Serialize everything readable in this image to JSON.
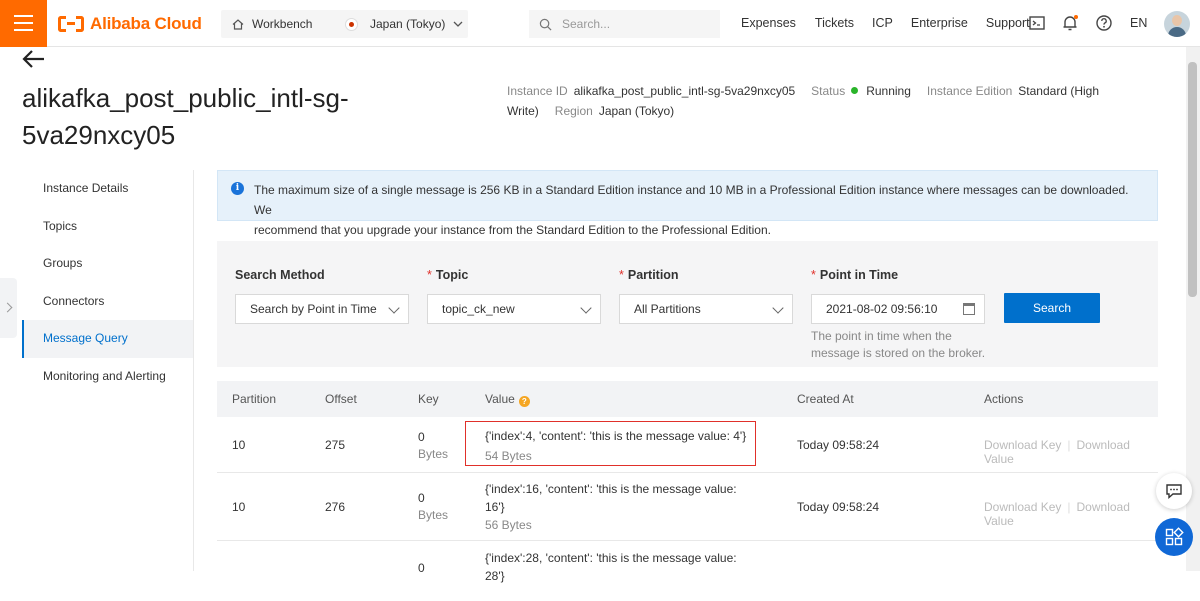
{
  "topbar": {
    "brand": "Alibaba Cloud",
    "workbench": "Workbench",
    "region": "Japan (Tokyo)",
    "search_placeholder": "Search...",
    "links": [
      "Expenses",
      "Tickets",
      "ICP",
      "Enterprise",
      "Support"
    ],
    "language": "EN",
    "icons": [
      "menu-icon",
      "home-icon",
      "chevron-down-icon",
      "search-icon",
      "terminal-icon",
      "bell-icon",
      "help-icon",
      "avatar"
    ]
  },
  "header": {
    "back_icon": "arrow-left-icon",
    "title_line1": "alikafka_post_public_intl-sg-",
    "title_line2": "5va29nxcy05",
    "instance_id_label": "Instance ID",
    "instance_id": "alikafka_post_public_intl-sg-5va29nxcy05",
    "status_label": "Status",
    "status": "Running",
    "edition_label": "Instance Edition",
    "edition_line1": "Standard (High",
    "edition_line2": "Write)",
    "region_label": "Region",
    "region": "Japan (Tokyo)"
  },
  "sidebar": {
    "items": [
      {
        "label": "Instance Details"
      },
      {
        "label": "Topics"
      },
      {
        "label": "Groups"
      },
      {
        "label": "Connectors"
      },
      {
        "label": "Message Query"
      },
      {
        "label": "Monitoring and Alerting"
      }
    ],
    "active_index": 4
  },
  "notice": {
    "line1": "The maximum size of a single message is 256 KB in a Standard Edition instance and 10 MB in a Professional Edition instance where messages can be downloaded. We",
    "line2": "recommend that you upgrade your instance from the Standard Edition to the Professional Edition."
  },
  "filters": {
    "search_method_label": "Search Method",
    "search_method_value": "Search by Point in Time",
    "topic_label": "Topic",
    "topic_value": "topic_ck_new",
    "partition_label": "Partition",
    "partition_value": "All Partitions",
    "point_label": "Point in Time",
    "point_value": "2021-08-02 09:56:10",
    "hint_line1": "The point in time when the",
    "hint_line2": "message is stored on the broker.",
    "search_button": "Search"
  },
  "table": {
    "columns": [
      "Partition",
      "Offset",
      "Key",
      "Value",
      "Created At",
      "Actions"
    ],
    "rows": [
      {
        "partition": "10",
        "offset": "275",
        "key": "0",
        "key_unit": "Bytes",
        "value_line1": "{'index':4, 'content': 'this is the message value: 4'}",
        "value_line2": "",
        "value_size": "54 Bytes",
        "created": "Today 09:58:24",
        "action1": "Download Key",
        "action2": "Download Value"
      },
      {
        "partition": "10",
        "offset": "276",
        "key": "0",
        "key_unit": "Bytes",
        "value_line1": "{'index':16, 'content': 'this is the message value:",
        "value_line2": "16'}",
        "value_size": "56 Bytes",
        "created": "Today 09:58:24",
        "action1": "Download Key",
        "action2": "Download Value"
      },
      {
        "partition": "",
        "offset": "",
        "key": "0",
        "key_unit": "",
        "value_line1": "{'index':28, 'content': 'this is the message value:",
        "value_line2": "28'}",
        "value_size": "",
        "created": "",
        "action1": "",
        "action2": ""
      }
    ]
  },
  "colors": {
    "brand": "#ff6a00",
    "primary": "#0070cc",
    "status_running": "#2ab42a",
    "highlight": "#e0302a"
  }
}
